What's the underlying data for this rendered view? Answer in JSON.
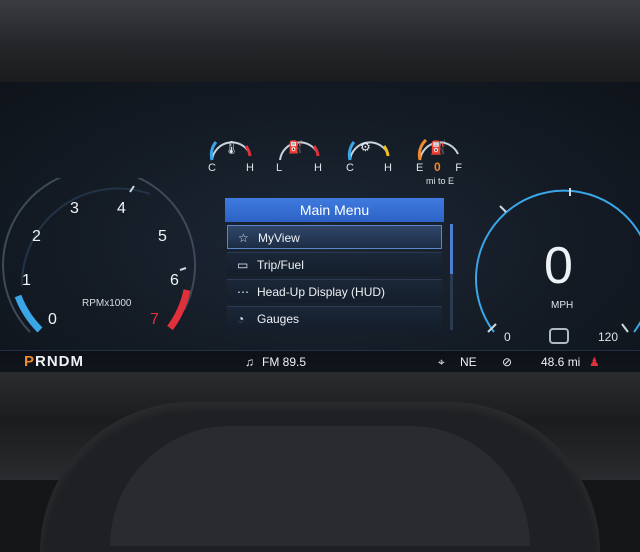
{
  "tach": {
    "labels": [
      "0",
      "1",
      "2",
      "3",
      "4",
      "5",
      "6",
      "7"
    ],
    "units": "RPMx1000",
    "colors": {
      "low": "#3aa6e8",
      "redline": "#e0303a"
    }
  },
  "mini_gauges": [
    {
      "name": "coolant-temp",
      "left": "C",
      "right": "H",
      "icon": "coolant-icon"
    },
    {
      "name": "oil-pressure",
      "left": "L",
      "right": "H",
      "icon": "oil-can-icon"
    },
    {
      "name": "trans-temp",
      "left": "C",
      "right": "H",
      "icon": "trans-temp-icon"
    },
    {
      "name": "fuel",
      "left": "E",
      "right": "F",
      "value": "0",
      "sub": "mi to E",
      "icon": "fuel-pump-icon"
    }
  ],
  "menu": {
    "title": "Main Menu",
    "items": [
      {
        "label": "MyView",
        "icon": "star-icon",
        "selected": true
      },
      {
        "label": "Trip/Fuel",
        "icon": "fuel-trip-icon",
        "selected": false
      },
      {
        "label": "Head-Up Display (HUD)",
        "icon": "hud-icon",
        "selected": false
      },
      {
        "label": "Gauges",
        "icon": "gauge-icon",
        "selected": false
      }
    ]
  },
  "speedometer": {
    "speed": "0",
    "unit": "MPH",
    "min": "0",
    "max": "120"
  },
  "status_bar": {
    "gear": {
      "selected": "P",
      "rest": "RNDM"
    },
    "radio": "FM 89.5",
    "compass": "NE",
    "range": "48.6 mi",
    "accent": "#f08a2a"
  }
}
